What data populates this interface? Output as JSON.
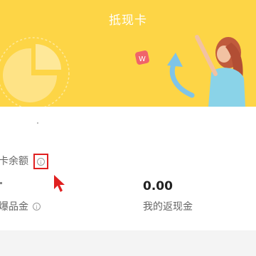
{
  "header": {
    "title": "抵现卡"
  },
  "card": {
    "balance_label": "卡余额",
    "info_icon": "info-circle-icon",
    "left_label": "爆品金",
    "right_value": "0.00",
    "right_label": "我的返现金"
  },
  "colors": {
    "header_bg": "#FDD546",
    "highlight_box": "#E02020",
    "cursor": "#E02020"
  }
}
